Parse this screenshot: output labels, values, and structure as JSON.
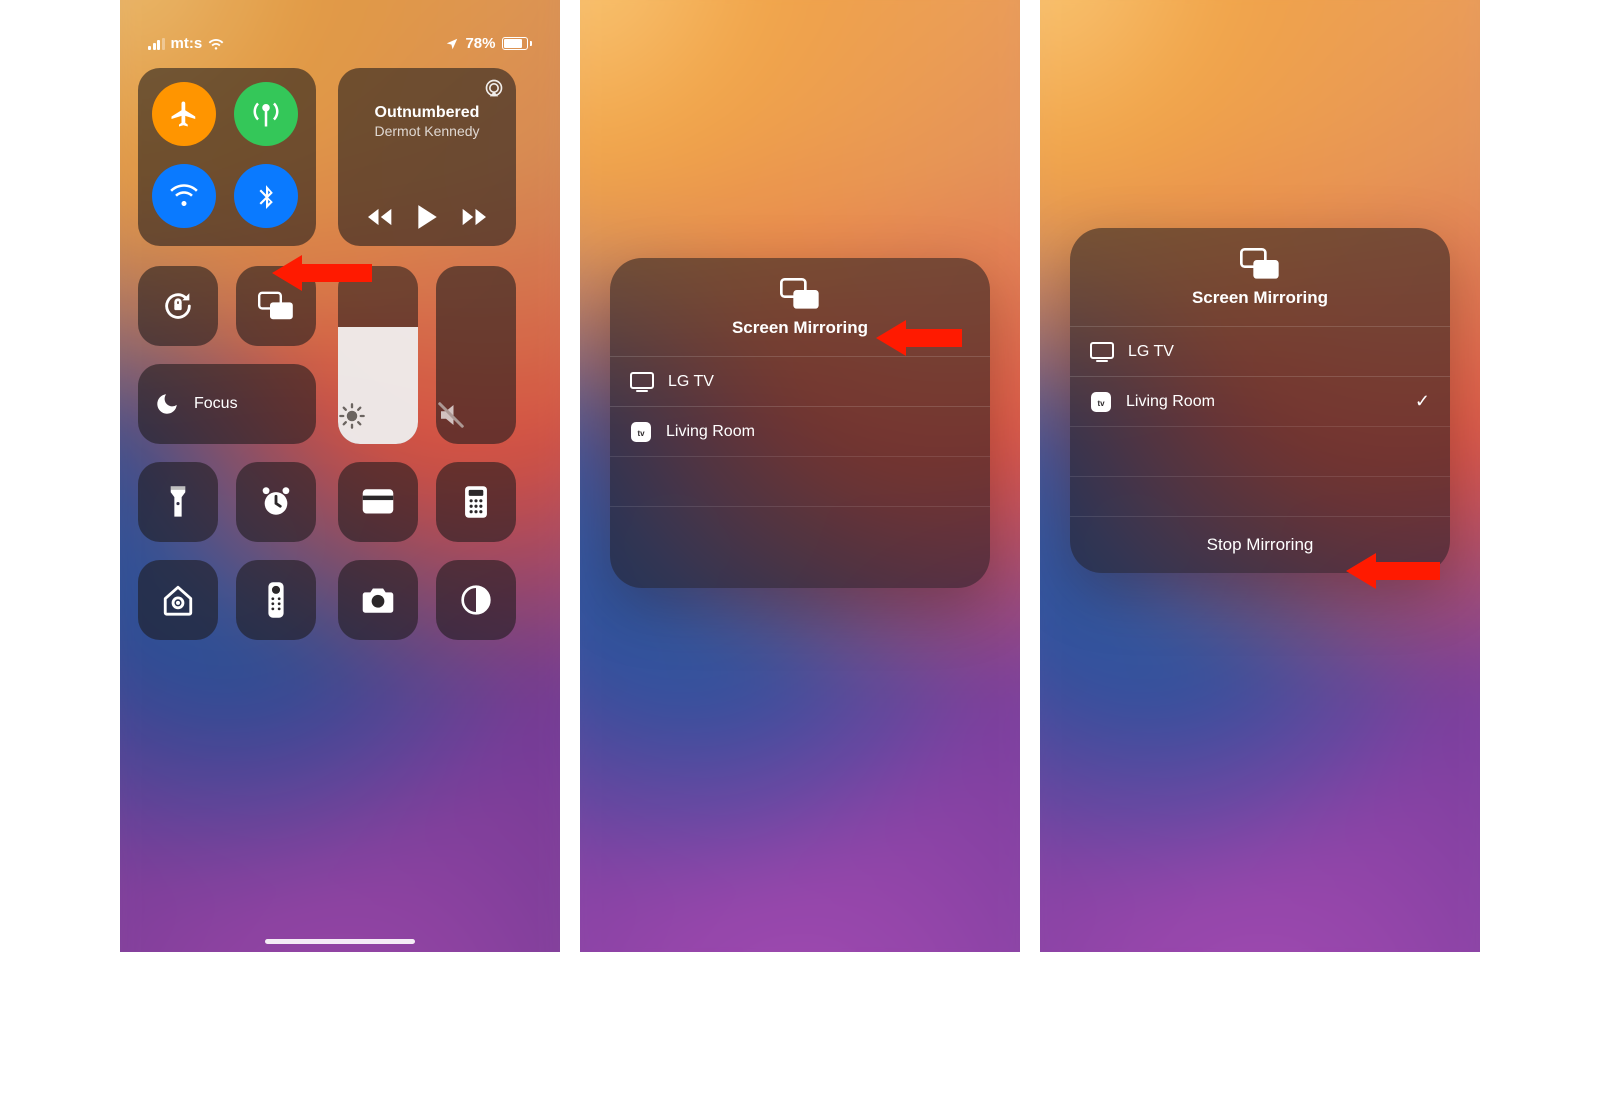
{
  "status": {
    "carrier": "mt:s",
    "battery_percent": "78%"
  },
  "media": {
    "title": "Outnumbered",
    "artist": "Dermot Kennedy"
  },
  "focus_label": "Focus",
  "screen_mirroring": {
    "title": "Screen Mirroring",
    "devices": [
      {
        "name": "LG TV",
        "icon": "tv"
      },
      {
        "name": "Living Room",
        "icon": "apple-tv"
      }
    ],
    "selected_index": 1,
    "stop_label": "Stop Mirroring"
  }
}
